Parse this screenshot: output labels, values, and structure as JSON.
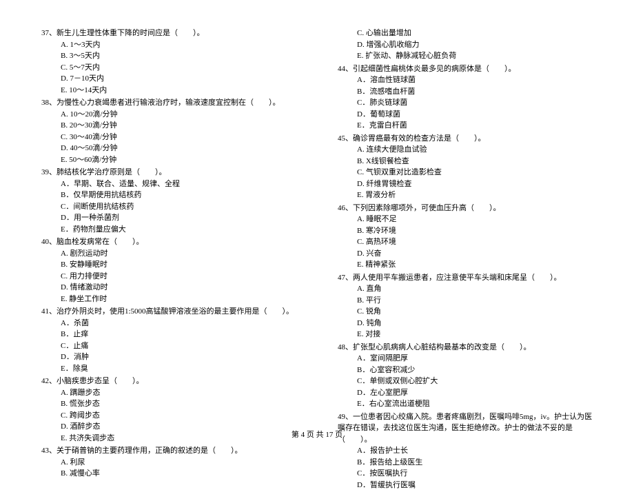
{
  "left": [
    {
      "num": "37",
      "stem": "新生儿生理性体重下降的时间应是（　　）。",
      "opts": [
        "A. 1～3天内",
        "B. 3～5天内",
        "C. 5～7天内",
        "D. 7－10天内",
        "E. 10～14天内"
      ]
    },
    {
      "num": "38",
      "stem": "为慢性心力衰竭患者进行输液治疗时，输液速度宜控制在（　　）。",
      "opts": [
        "A. 10～20滴/分钟",
        "B. 20～30滴/分钟",
        "C. 30～40滴/分钟",
        "D. 40～50滴/分钟",
        "E. 50～60滴/分钟"
      ]
    },
    {
      "num": "39",
      "stem": "肺结核化学治疗原则是（　　）。",
      "opts": [
        "A．早期、联合、适量、规律、全程",
        "B．仅早期使用抗结核药",
        "C．间断使用抗结核药",
        "D．用一种杀菌剂",
        "E．药物剂量应偏大"
      ]
    },
    {
      "num": "40",
      "stem": "脑血栓发病常在（　　）。",
      "opts": [
        "A. 剧烈运动时",
        "B. 安静睡眠时",
        "C. 用力排便时",
        "D. 情绪激动时",
        "E. 静坐工作时"
      ]
    },
    {
      "num": "41",
      "stem": "治疗外阴炎时，使用1:5000高锰酸钾溶液坐浴的最主要作用是（　　）。",
      "opts": [
        "A．杀菌",
        "B．止痒",
        "C．止痛",
        "D．消肿",
        "E．除臭"
      ]
    },
    {
      "num": "42",
      "stem": "小脑疾患步态呈（　　）。",
      "opts": [
        "A. 蹒跚步态",
        "B. 慌张步态",
        "C. 跨阈步态",
        "D. 酒醉步态",
        "E. 共济失调步态"
      ]
    },
    {
      "num": "43",
      "stem": "关于硝普钠的主要药理作用，正确的叙述的是（　　）。",
      "opts": [
        "A. 利尿",
        "B. 减慢心率"
      ]
    }
  ],
  "right": [
    {
      "num": "",
      "stem": "",
      "opts": [
        "C. 心输出量增加",
        "D. 增强心肌收缩力",
        "E. 扩张动、静脉减轻心脏负荷"
      ]
    },
    {
      "num": "44",
      "stem": "引起细菌性扁桃体炎最多见的病原体是（　　）。",
      "opts": [
        "A．溶血性链球菌",
        "B．流感嗜血杆菌",
        "C．肺炎链球菌",
        "D．葡萄球菌",
        "E．克雷白杆菌"
      ]
    },
    {
      "num": "45",
      "stem": "确诊胃癌最有效的检查方法是（　　）。",
      "opts": [
        "A. 连续大便隐血试验",
        "B. X线钡餐检查",
        "C. 气钡双重对比造影检查",
        "D. 纤维胃镜检查",
        "E. 胃液分析"
      ]
    },
    {
      "num": "46",
      "stem": "下列因素除哪项外，可使血压升高（　　）。",
      "opts": [
        "A. 睡眠不足",
        "B. 寒冷环境",
        "C. 高热环境",
        "D. 兴奋",
        "E. 精神紧张"
      ]
    },
    {
      "num": "47",
      "stem": "两人使用平车搬运患者，应注意使平车头端和床尾呈（　　）。",
      "opts": [
        "A. 直角",
        "B. 平行",
        "C. 锐角",
        "D. 钝角",
        "E. 对接"
      ]
    },
    {
      "num": "48",
      "stem": "扩张型心肌病病人心脏结构最基本的改变是（　　）。",
      "opts": [
        "A．室间隔肥厚",
        "B．心室容积减少",
        "C．单侧或双侧心腔扩大",
        "D．左心室肥厚",
        "E．右心室流出道梗阻"
      ]
    },
    {
      "num": "49",
      "stem": "一位患者因心绞痛入院。患者疼痛剧烈，医嘱吗啡5mg，iv。护士认为医嘱存在错误，去找这位医生沟通，医生拒绝修改。护士的做法不妥的是（　　）。",
      "opts": [
        "A．报告护士长",
        "B．报告给上级医生",
        "C．按医嘱执行",
        "D．暂缓执行医嘱"
      ]
    }
  ],
  "footer": "第 4 页 共 17 页"
}
